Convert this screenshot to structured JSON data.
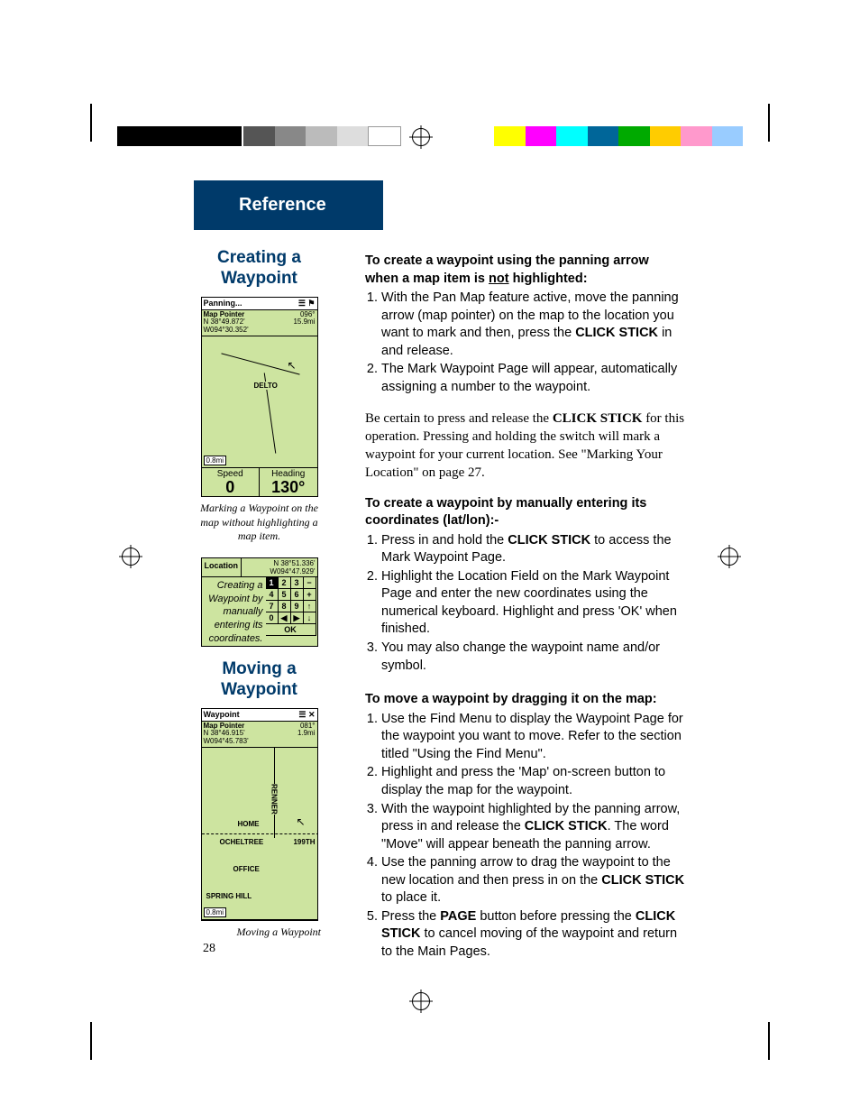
{
  "header": "Reference",
  "sidebar": {
    "title1": "Creating a Waypoint",
    "title2": "Moving a Waypoint",
    "screen1": {
      "title": "Panning...",
      "icons": "☰ ⚑",
      "ptr": "Map Pointer",
      "lat": "N  38°49.872'",
      "lon": "W094°30.352'",
      "brg": "096°",
      "dist": "15.9mi",
      "labels": [
        "DELTO"
      ],
      "scale": "0.8mi",
      "speedLbl": "Speed",
      "speedVal": "0",
      "hdgLbl": "Heading",
      "hdgVal": "130°"
    },
    "caption1": "Marking a Waypoint on the map without highlighting a map item.",
    "keypad": {
      "loc": "Location",
      "lat": "N  38°51.336'",
      "lon": "W094°47.929'",
      "text": "Creating a Waypoint by manually entering its coordinates.",
      "keys": [
        "1",
        "2",
        "3",
        "−",
        "4",
        "5",
        "6",
        "+",
        "7",
        "8",
        "9",
        "↑",
        "0",
        "◀",
        "▶",
        "↓"
      ],
      "ok": "OK"
    },
    "screen2": {
      "title": "Waypoint",
      "icons": "☰ ✕",
      "ptr": "Map Pointer",
      "lat": "N  38°46.915'",
      "lon": "W094°45.783'",
      "brg": "081°",
      "dist": "1.9mi",
      "labels": [
        "RENNER",
        "HOME",
        "OCHELTREE",
        "199TH",
        "OFFICE",
        "SPRING HILL"
      ],
      "scale": "0.8mi"
    },
    "caption2": "Moving a Waypoint"
  },
  "content": {
    "h1a": "To create a waypoint using the panning ",
    "h1b": "arrow when a map item is ",
    "h1not": "not",
    "h1c": " highlighted:",
    "l1": [
      {
        "a": "With the Pan Map feature active, move the panning arrow (map pointer) on the map to the location you want to mark and then, press the ",
        "b": "CLICK STICK",
        "c": " in and release."
      },
      {
        "a": "The Mark Waypoint Page will appear, automatically assigning a number to the waypoint."
      }
    ],
    "p1a": "   Be certain to press and release the ",
    "p1b": "CLICK STICK",
    "p1c": " for this operation. Pressing and holding the switch will mark a waypoint for your current location. See \"Marking Your Location\" on page 27.",
    "h2": "To create a waypoint by manually entering its coordinates (lat/lon):-",
    "l2": [
      {
        "a": "Press in and hold the ",
        "b": "CLICK STICK",
        "c": " to access the Mark Waypoint Page."
      },
      {
        "a": "Highlight the Location Field on the Mark Waypoint Page and enter the new coordinates using the numerical keyboard. Highlight and press 'OK' when finished."
      },
      {
        "a": "You may also change the waypoint name and/or symbol."
      }
    ],
    "h3": "To move a waypoint by dragging it on the map:",
    "l3": [
      {
        "a": "Use the Find Menu to display the Waypoint Page for the waypoint you want to move. Refer to the section titled \"Using the Find Menu\"."
      },
      {
        "a": "Highlight and press the 'Map' on-screen button to display the map for the waypoint."
      },
      {
        "a": "With the waypoint highlighted by the panning arrow, press in and release the ",
        "b": "CLICK STICK",
        "c": ". The word \"Move\" will appear beneath the panning arrow."
      },
      {
        "a": "Use the panning arrow to drag the waypoint to the new location and then press in on the ",
        "b": "CLICK STICK",
        "c": " to place it."
      },
      {
        "a": "Press the ",
        "b": "PAGE",
        "c": " button before pressing the ",
        "d": "CLICK STICK",
        "e": " to cancel moving of the waypoint and return to the Main Pages."
      }
    ]
  },
  "pageNum": "28",
  "colors": [
    "#000",
    "#000",
    "#000",
    "#000",
    "#555",
    "#888",
    "#bbb",
    "#ddd",
    "#fff",
    "#fff",
    "#ff0",
    "#f0f",
    "#0ff",
    "#08f",
    "#0c0",
    "#fc0",
    "#f9c",
    "#9cf"
  ]
}
